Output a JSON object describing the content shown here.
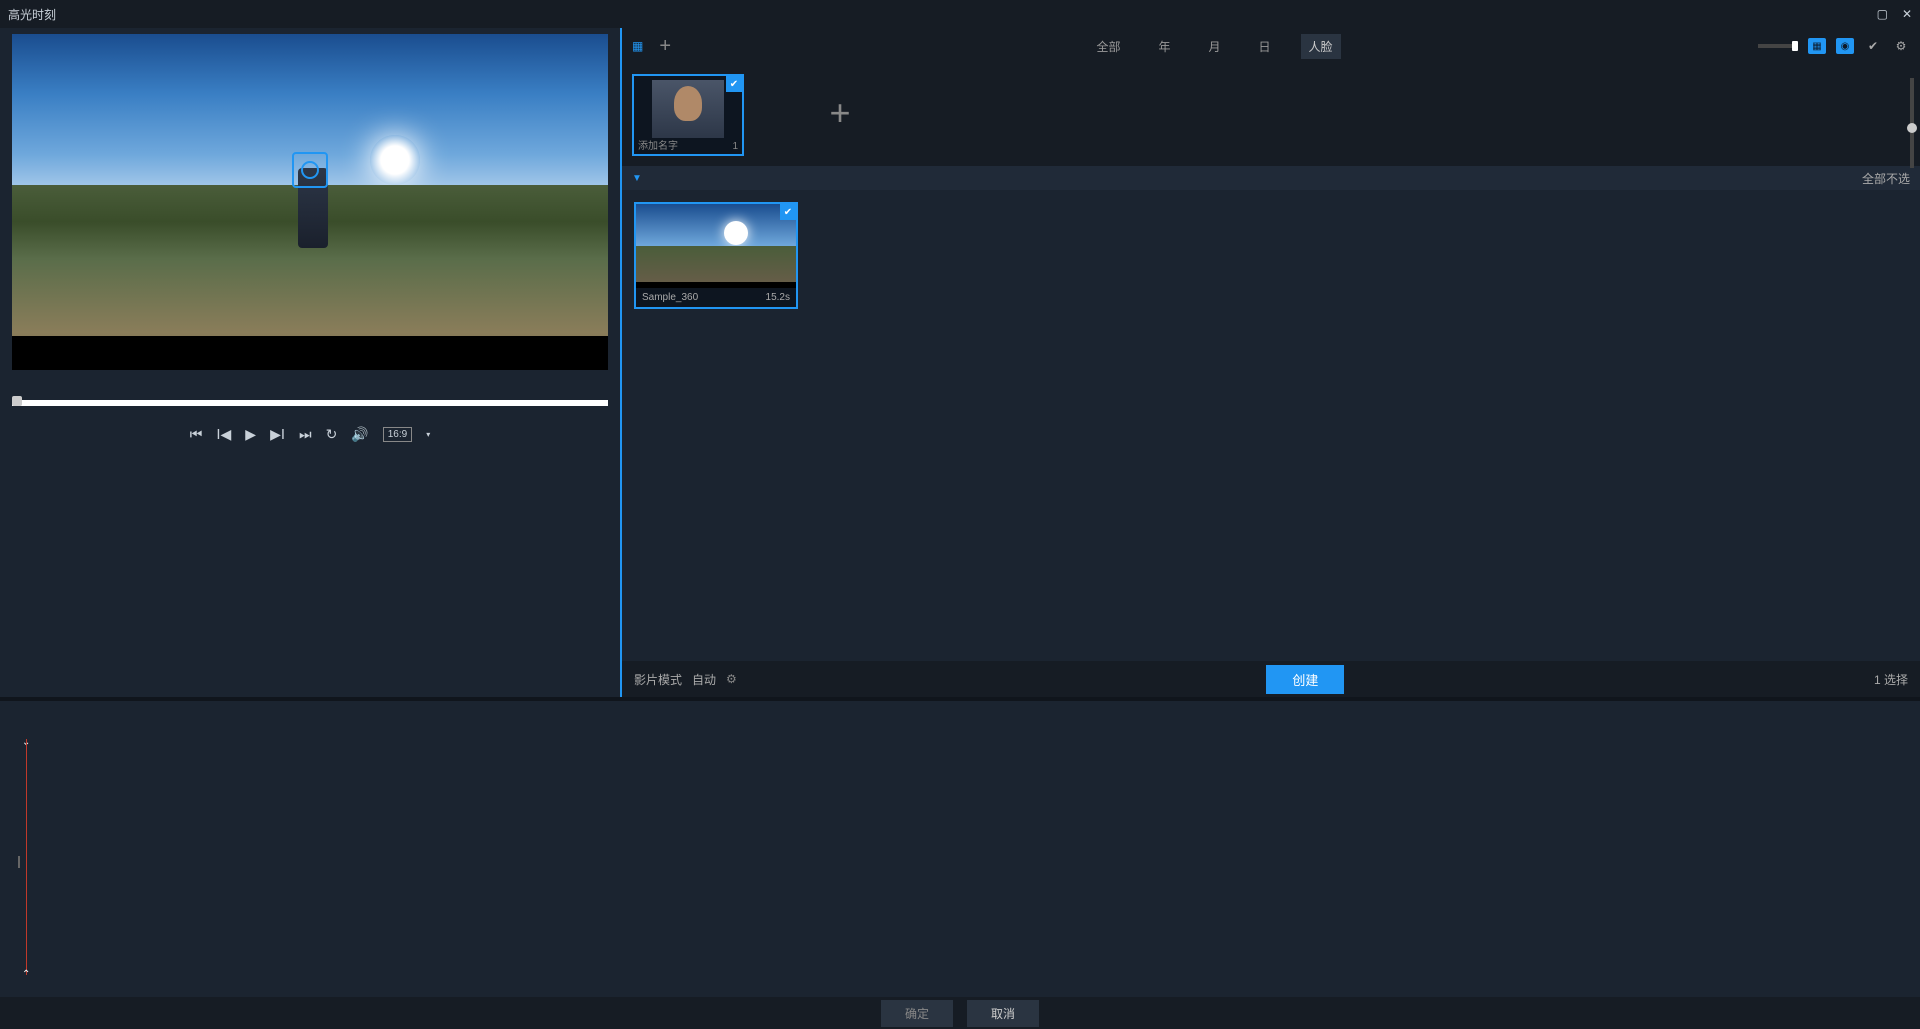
{
  "window": {
    "title": "高光时刻"
  },
  "player": {
    "aspect_ratio": "16:9"
  },
  "topbar": {
    "filters": {
      "all": "全部",
      "year": "年",
      "month": "月",
      "day": "日",
      "face": "人脸"
    }
  },
  "faces": {
    "items": [
      {
        "label": "添加名字",
        "count": "1"
      }
    ]
  },
  "selection_header": {
    "deselect_all": "全部不选"
  },
  "clips": {
    "items": [
      {
        "name": "Sample_360",
        "duration": "15.2s"
      }
    ]
  },
  "footer_row": {
    "mode_label": "影片模式",
    "mode_value": "自动",
    "create": "创建",
    "selected_count": "1 选择"
  },
  "dialog_footer": {
    "ok": "确定",
    "cancel": "取消"
  }
}
